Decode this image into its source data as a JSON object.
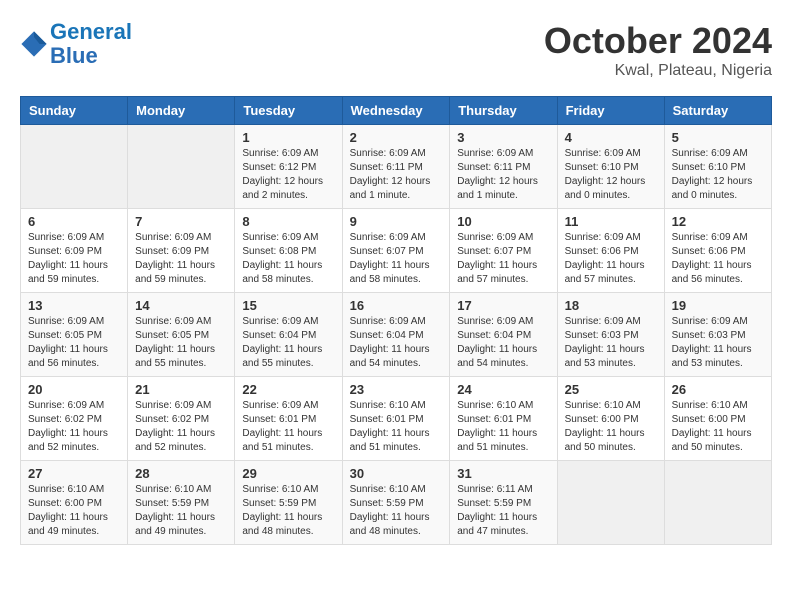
{
  "header": {
    "logo_line1": "General",
    "logo_line2": "Blue",
    "month": "October 2024",
    "location": "Kwal, Plateau, Nigeria"
  },
  "days_of_week": [
    "Sunday",
    "Monday",
    "Tuesday",
    "Wednesday",
    "Thursday",
    "Friday",
    "Saturday"
  ],
  "weeks": [
    [
      {
        "day": "",
        "info": ""
      },
      {
        "day": "",
        "info": ""
      },
      {
        "day": "1",
        "info": "Sunrise: 6:09 AM\nSunset: 6:12 PM\nDaylight: 12 hours and 2 minutes."
      },
      {
        "day": "2",
        "info": "Sunrise: 6:09 AM\nSunset: 6:11 PM\nDaylight: 12 hours and 1 minute."
      },
      {
        "day": "3",
        "info": "Sunrise: 6:09 AM\nSunset: 6:11 PM\nDaylight: 12 hours and 1 minute."
      },
      {
        "day": "4",
        "info": "Sunrise: 6:09 AM\nSunset: 6:10 PM\nDaylight: 12 hours and 0 minutes."
      },
      {
        "day": "5",
        "info": "Sunrise: 6:09 AM\nSunset: 6:10 PM\nDaylight: 12 hours and 0 minutes."
      }
    ],
    [
      {
        "day": "6",
        "info": "Sunrise: 6:09 AM\nSunset: 6:09 PM\nDaylight: 11 hours and 59 minutes."
      },
      {
        "day": "7",
        "info": "Sunrise: 6:09 AM\nSunset: 6:09 PM\nDaylight: 11 hours and 59 minutes."
      },
      {
        "day": "8",
        "info": "Sunrise: 6:09 AM\nSunset: 6:08 PM\nDaylight: 11 hours and 58 minutes."
      },
      {
        "day": "9",
        "info": "Sunrise: 6:09 AM\nSunset: 6:07 PM\nDaylight: 11 hours and 58 minutes."
      },
      {
        "day": "10",
        "info": "Sunrise: 6:09 AM\nSunset: 6:07 PM\nDaylight: 11 hours and 57 minutes."
      },
      {
        "day": "11",
        "info": "Sunrise: 6:09 AM\nSunset: 6:06 PM\nDaylight: 11 hours and 57 minutes."
      },
      {
        "day": "12",
        "info": "Sunrise: 6:09 AM\nSunset: 6:06 PM\nDaylight: 11 hours and 56 minutes."
      }
    ],
    [
      {
        "day": "13",
        "info": "Sunrise: 6:09 AM\nSunset: 6:05 PM\nDaylight: 11 hours and 56 minutes."
      },
      {
        "day": "14",
        "info": "Sunrise: 6:09 AM\nSunset: 6:05 PM\nDaylight: 11 hours and 55 minutes."
      },
      {
        "day": "15",
        "info": "Sunrise: 6:09 AM\nSunset: 6:04 PM\nDaylight: 11 hours and 55 minutes."
      },
      {
        "day": "16",
        "info": "Sunrise: 6:09 AM\nSunset: 6:04 PM\nDaylight: 11 hours and 54 minutes."
      },
      {
        "day": "17",
        "info": "Sunrise: 6:09 AM\nSunset: 6:04 PM\nDaylight: 11 hours and 54 minutes."
      },
      {
        "day": "18",
        "info": "Sunrise: 6:09 AM\nSunset: 6:03 PM\nDaylight: 11 hours and 53 minutes."
      },
      {
        "day": "19",
        "info": "Sunrise: 6:09 AM\nSunset: 6:03 PM\nDaylight: 11 hours and 53 minutes."
      }
    ],
    [
      {
        "day": "20",
        "info": "Sunrise: 6:09 AM\nSunset: 6:02 PM\nDaylight: 11 hours and 52 minutes."
      },
      {
        "day": "21",
        "info": "Sunrise: 6:09 AM\nSunset: 6:02 PM\nDaylight: 11 hours and 52 minutes."
      },
      {
        "day": "22",
        "info": "Sunrise: 6:09 AM\nSunset: 6:01 PM\nDaylight: 11 hours and 51 minutes."
      },
      {
        "day": "23",
        "info": "Sunrise: 6:10 AM\nSunset: 6:01 PM\nDaylight: 11 hours and 51 minutes."
      },
      {
        "day": "24",
        "info": "Sunrise: 6:10 AM\nSunset: 6:01 PM\nDaylight: 11 hours and 51 minutes."
      },
      {
        "day": "25",
        "info": "Sunrise: 6:10 AM\nSunset: 6:00 PM\nDaylight: 11 hours and 50 minutes."
      },
      {
        "day": "26",
        "info": "Sunrise: 6:10 AM\nSunset: 6:00 PM\nDaylight: 11 hours and 50 minutes."
      }
    ],
    [
      {
        "day": "27",
        "info": "Sunrise: 6:10 AM\nSunset: 6:00 PM\nDaylight: 11 hours and 49 minutes."
      },
      {
        "day": "28",
        "info": "Sunrise: 6:10 AM\nSunset: 5:59 PM\nDaylight: 11 hours and 49 minutes."
      },
      {
        "day": "29",
        "info": "Sunrise: 6:10 AM\nSunset: 5:59 PM\nDaylight: 11 hours and 48 minutes."
      },
      {
        "day": "30",
        "info": "Sunrise: 6:10 AM\nSunset: 5:59 PM\nDaylight: 11 hours and 48 minutes."
      },
      {
        "day": "31",
        "info": "Sunrise: 6:11 AM\nSunset: 5:59 PM\nDaylight: 11 hours and 47 minutes."
      },
      {
        "day": "",
        "info": ""
      },
      {
        "day": "",
        "info": ""
      }
    ]
  ]
}
